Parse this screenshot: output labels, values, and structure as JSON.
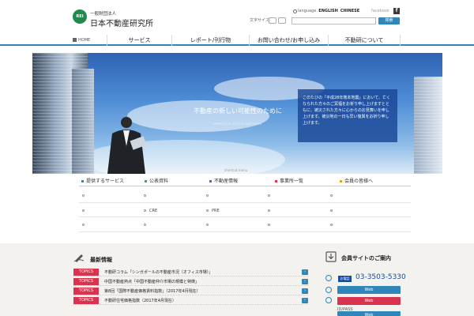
{
  "header": {
    "logo_mark": "REI",
    "logo_sub": "一般財団法人",
    "logo_main": "日本不動産研究所",
    "language_label": "language",
    "lang_english": "ENGLISH",
    "lang_chinese": "CHINESE",
    "facebook": "facebook",
    "font_size_label": "文字サイズ",
    "search_button": "検索"
  },
  "nav": {
    "home": "HOME",
    "items": [
      "サービス",
      "レポート/刊行物",
      "お問い合わせ/お申し込み",
      "不動研について"
    ]
  },
  "hero": {
    "title": "不動産の新しい可能性のために",
    "subtitle": "JAPAN REAL ESTATE INSTITUTE",
    "notice": "このたびの「平成28年熊本地震」において、亡くなられた方々のご冥福をお祈り申し上げますとともに、被災された方々に心からのお見舞いを申し上げます。被災地の一日も早い復興をお祈り申し上げます。"
  },
  "shortcut": {
    "label": "shortcut menu",
    "tabs": [
      {
        "label": "提供するサービス",
        "color": "#2f86b8"
      },
      {
        "label": "公表資料",
        "color": "#3aa65a"
      },
      {
        "label": "不動産情報",
        "color": "#8a4fa8"
      },
      {
        "label": "事業所一覧",
        "color": "#d9344f"
      },
      {
        "label": "会員の皆様へ",
        "color": "#e3a21a"
      }
    ],
    "row2_items": [
      "CRE",
      "PRE"
    ]
  },
  "news": {
    "title": "最新情報",
    "items": [
      {
        "tag": "TOPICS",
        "text": "不動研コラム「シンガポールの不動産市況（オフィス市場）」"
      },
      {
        "tag": "TOPICS",
        "text": "中国不動産熱点「中国不動産仲介市場の規模と特徴」"
      },
      {
        "tag": "TOPICS",
        "text": "第8回「国際不動産価格賃料指数」（2017年4月現在）"
      },
      {
        "tag": "TOPICS",
        "text": "不動研住宅価格指数（2017年4月現在）"
      }
    ]
  },
  "member": {
    "title": "会員サイトのご案内",
    "phone_badge": "お電話",
    "phone": "03-3503-5330",
    "web_buttons": [
      {
        "label": "Web",
        "color": "#2f86b8"
      },
      {
        "label": "Web",
        "color": "#d9344f"
      },
      {
        "label": "Web",
        "color": "#2f86b8"
      }
    ],
    "idpass": "ID/PASS"
  }
}
